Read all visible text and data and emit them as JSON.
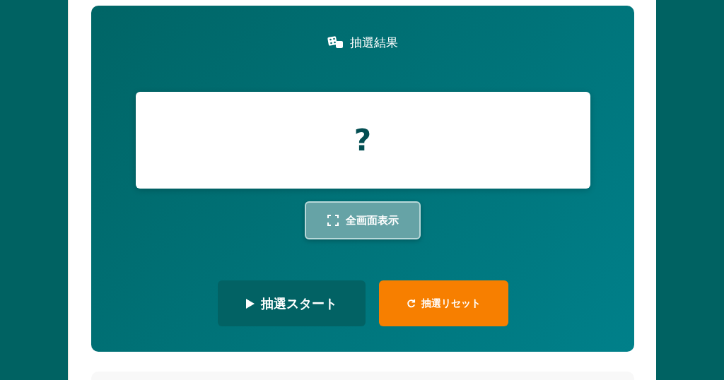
{
  "result_panel": {
    "title": "抽選結果",
    "result": "?",
    "fullscreen_button": "全画面表示"
  },
  "actions": [
    {
      "kind": "start",
      "label": "抽選スタート"
    },
    {
      "kind": "reset",
      "label": "抽選リセット"
    }
  ]
}
